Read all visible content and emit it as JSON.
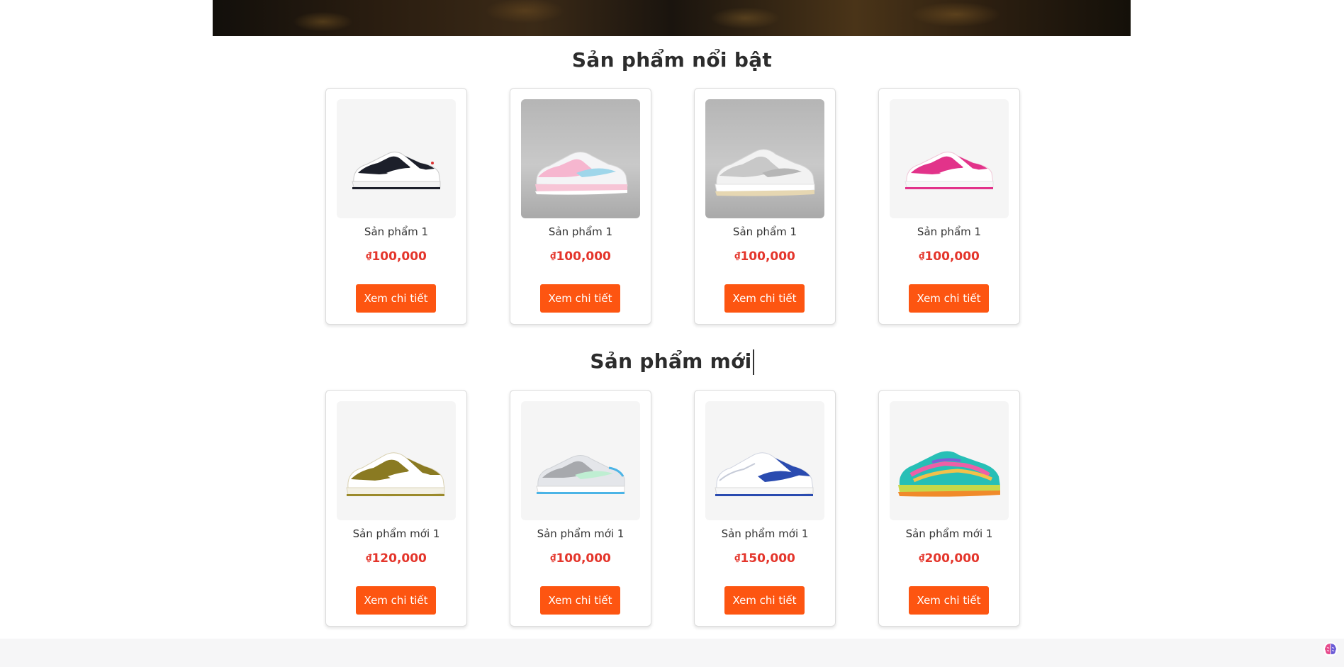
{
  "banner": {
    "description_icon": "banner-image"
  },
  "featured": {
    "title": "Sản phẩm nổi bật",
    "products": [
      {
        "name": "Sản phẩm 1",
        "currency": "₫",
        "price": "100,000",
        "button": "Xem chi tiết",
        "shoe": "panda-black-white"
      },
      {
        "name": "Sản phẩm 1",
        "currency": "₫",
        "price": "100,000",
        "button": "Xem chi tiết",
        "shoe": "pink-light-blue"
      },
      {
        "name": "Sản phẩm 1",
        "currency": "₫",
        "price": "100,000",
        "button": "Xem chi tiết",
        "shoe": "grey-sail"
      },
      {
        "name": "Sản phẩm 1",
        "currency": "₫",
        "price": "100,000",
        "button": "Xem chi tiết",
        "shoe": "hot-pink"
      }
    ]
  },
  "new_products": {
    "title": "Sản phẩm mới",
    "products": [
      {
        "name": "Sản phẩm mới 1",
        "currency": "₫",
        "price": "120,000",
        "button": "Xem chi tiết",
        "shoe": "olive-white"
      },
      {
        "name": "Sản phẩm mới 1",
        "currency": "₫",
        "price": "100,000",
        "button": "Xem chi tiết",
        "shoe": "grey-mint-blue"
      },
      {
        "name": "Sản phẩm mới 1",
        "currency": "₫",
        "price": "150,000",
        "button": "Xem chi tiết",
        "shoe": "white-royal-blue"
      },
      {
        "name": "Sản phẩm mới 1",
        "currency": "₫",
        "price": "200,000",
        "button": "Xem chi tiết",
        "shoe": "multicolor-teal"
      }
    ]
  },
  "colors": {
    "accent": "#fd5511",
    "price": "#e4352b"
  }
}
